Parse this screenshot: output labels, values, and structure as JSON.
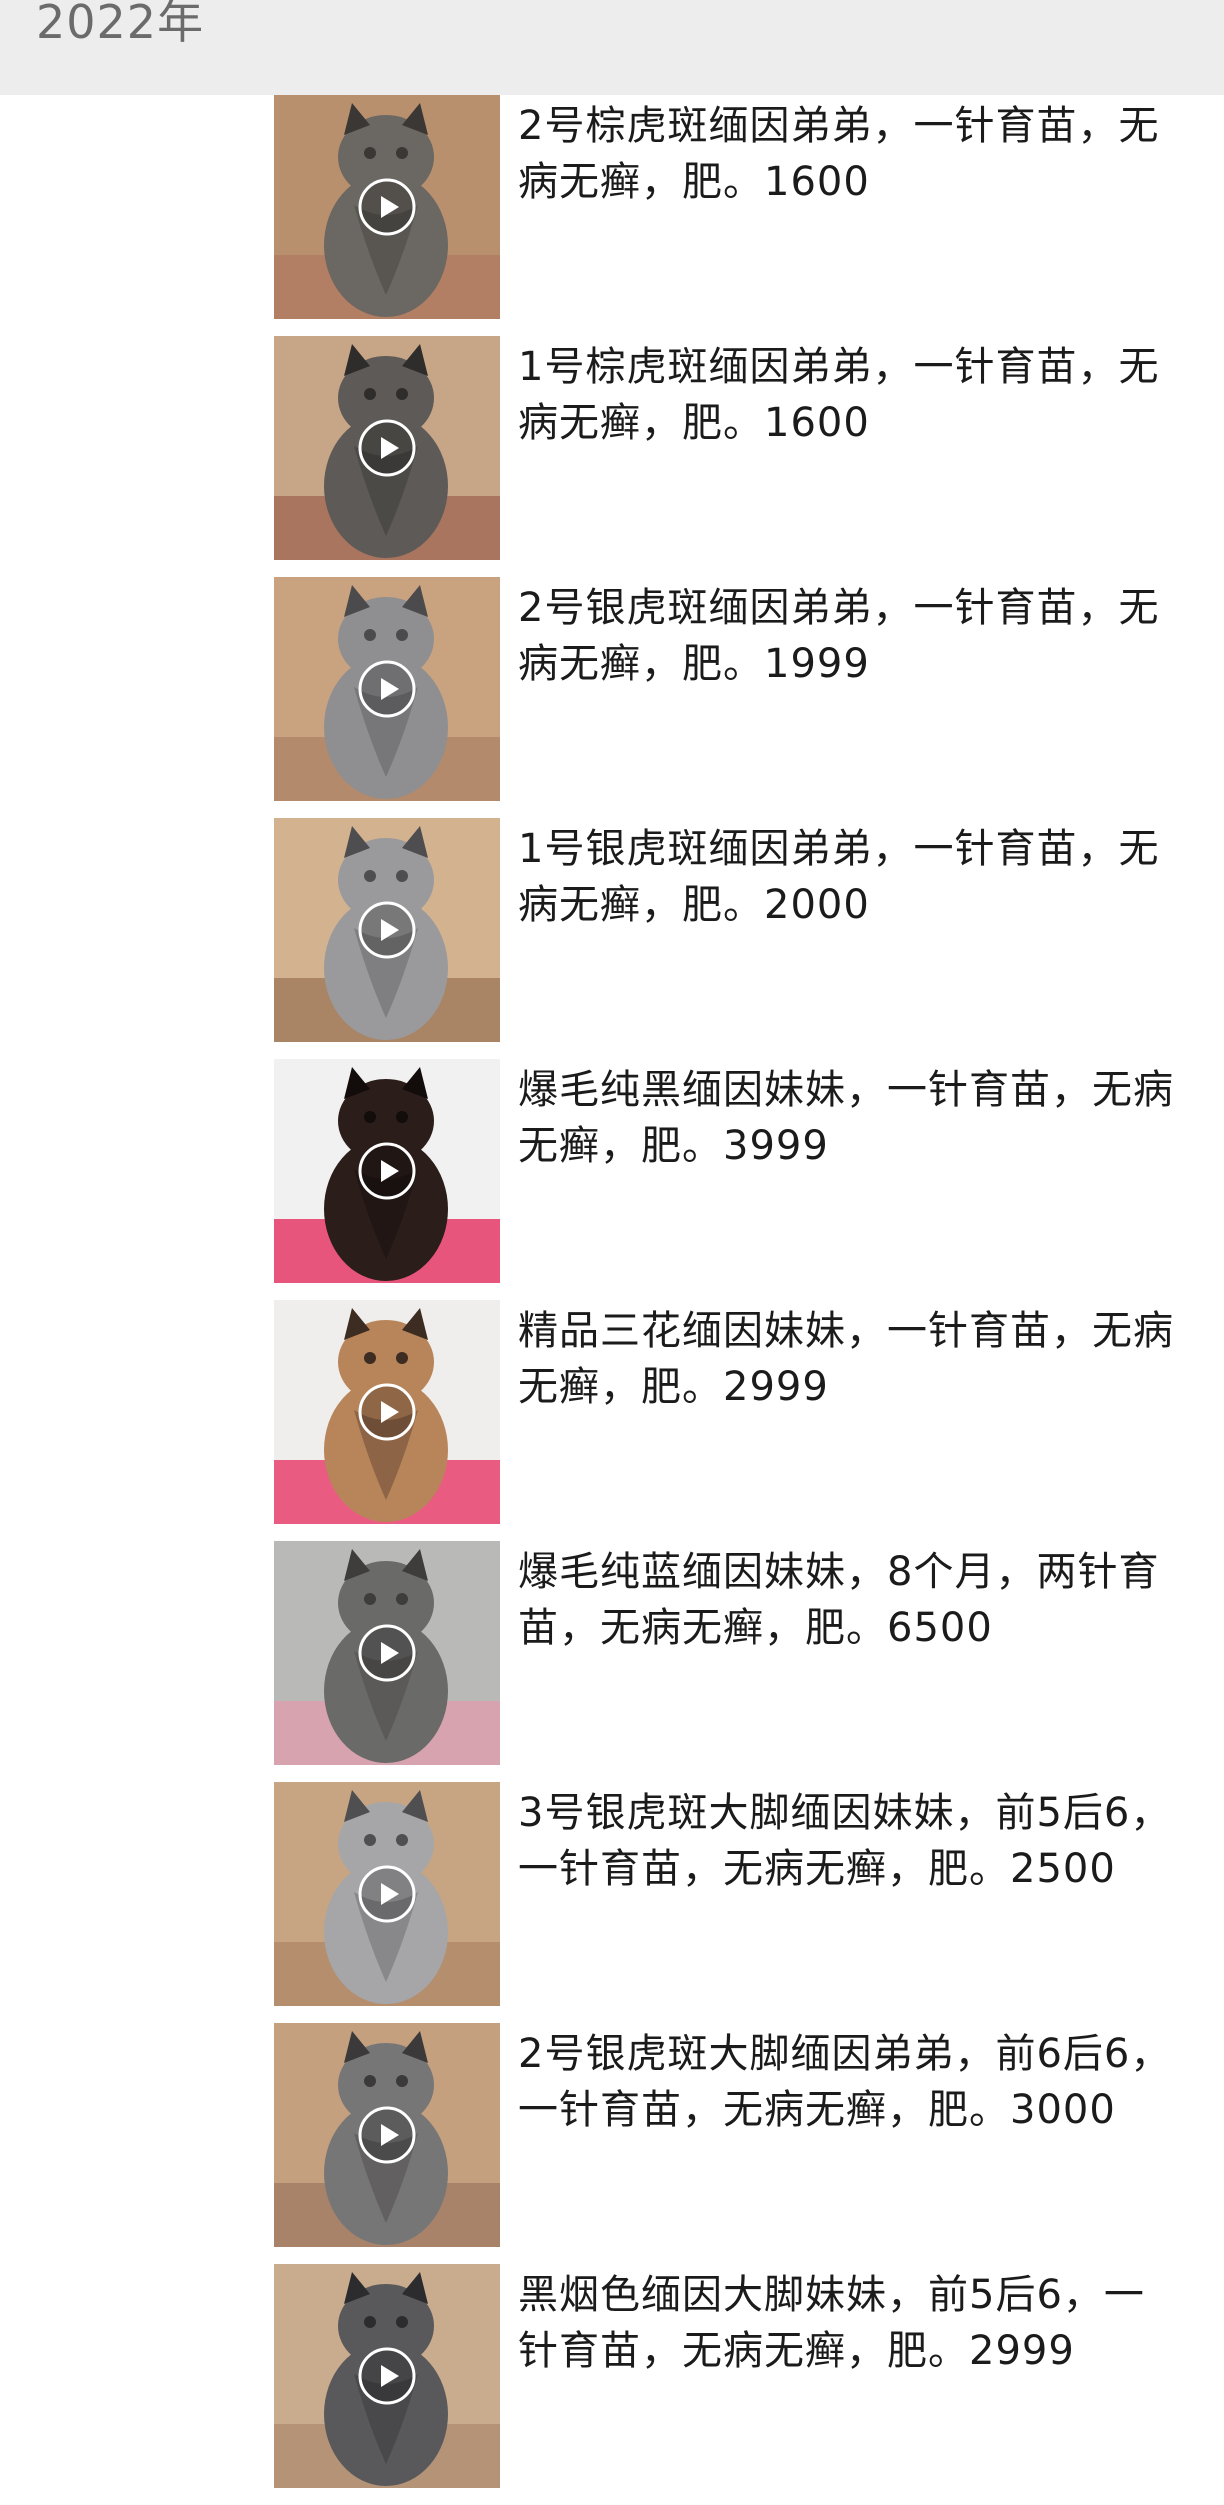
{
  "header": {
    "year": "2022年"
  },
  "posts": [
    {
      "caption": "2号棕虎斑缅因弟弟，一针育苗，无病无癣，肥。1600",
      "thumb": {
        "bg": "#b9906e",
        "floor": "#b27e64",
        "cat": "#6b6762",
        "dark": "#3a3734"
      }
    },
    {
      "caption": "1号棕虎斑缅因弟弟，一针育苗，无病无癣，肥。1600",
      "thumb": {
        "bg": "#c7a587",
        "floor": "#a9755e",
        "cat": "#5d5a57",
        "dark": "#2f2d2b"
      }
    },
    {
      "caption": "2号银虎斑缅因弟弟，一针育苗，无病无癣，肥。1999",
      "thumb": {
        "bg": "#c9a27f",
        "floor": "#b38a6b",
        "cat": "#8f8f91",
        "dark": "#4b4a4c"
      }
    },
    {
      "caption": "1号银虎斑缅因弟弟，一针育苗，无病无癣，肥。2000",
      "thumb": {
        "bg": "#d3b290",
        "floor": "#a98566",
        "cat": "#9a9a9c",
        "dark": "#4e4d4f"
      }
    },
    {
      "caption": "爆毛纯黑缅因妹妹，一针育苗，无病无癣，肥。3999",
      "thumb": {
        "bg": "#f1f1f1",
        "floor": "#e8557c",
        "cat": "#2a1d1a",
        "dark": "#120c0b"
      }
    },
    {
      "caption": "精品三花缅因妹妹，一针育苗，无病无癣，肥。2999",
      "thumb": {
        "bg": "#efeeec",
        "floor": "#ea5b81",
        "cat": "#b8855a",
        "dark": "#3d2c22"
      }
    },
    {
      "caption": "爆毛纯蓝缅因妹妹，8个月，两针育苗，无病无癣，肥。6500",
      "thumb": {
        "bg": "#b9b9b7",
        "floor": "#d7a3ae",
        "cat": "#6a6a69",
        "dark": "#3e3d3b"
      }
    },
    {
      "caption": "3号银虎斑大脚缅因妹妹，前5后6，一针育苗，无病无癣，肥。2500",
      "thumb": {
        "bg": "#c8a582",
        "floor": "#b58e6d",
        "cat": "#a6a6a8",
        "dark": "#4f4e50"
      }
    },
    {
      "caption": "2号银虎斑大脚缅因弟弟，前6后6，一针育苗，无病无癣，肥。3000",
      "thumb": {
        "bg": "#c4a07e",
        "floor": "#a8836a",
        "cat": "#777677",
        "dark": "#3b393a"
      }
    },
    {
      "caption": "黑烟色缅因大脚妹妹，前5后6，一针育苗，无病无癣，肥。2999",
      "thumb": {
        "bg": "#c9ab8e",
        "floor": "#b59377",
        "cat": "#59595c",
        "dark": "#2c2b2e"
      }
    }
  ]
}
